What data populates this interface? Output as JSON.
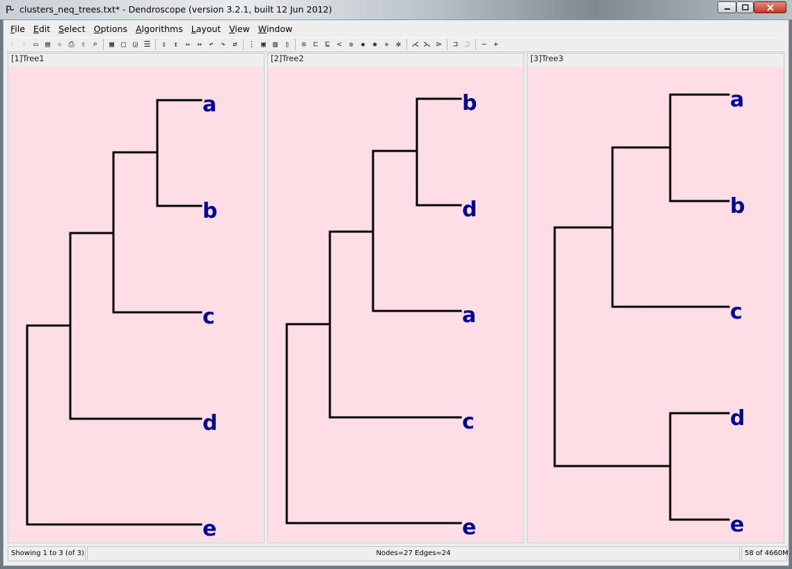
{
  "window": {
    "title": "clusters_neq_trees.txt* - Dendroscope (version 3.2.1, built 12 Jun 2012)"
  },
  "menu": [
    {
      "label": "File",
      "mnemonic": "F",
      "rest": "ile"
    },
    {
      "label": "Edit",
      "mnemonic": "E",
      "rest": "dit"
    },
    {
      "label": "Select",
      "mnemonic": "S",
      "rest": "elect"
    },
    {
      "label": "Options",
      "mnemonic": "O",
      "rest": "ptions"
    },
    {
      "label": "Algorithms",
      "mnemonic": "A",
      "rest": "lgorithms"
    },
    {
      "label": "Layout",
      "mnemonic": "L",
      "rest": "ayout"
    },
    {
      "label": "View",
      "mnemonic": "V",
      "rest": "iew"
    },
    {
      "label": "Window",
      "mnemonic": "W",
      "rest": "indow"
    }
  ],
  "toolbar": [
    {
      "name": "back-icon",
      "glyph": "‹",
      "enabled": false
    },
    {
      "name": "forward-icon",
      "glyph": "›",
      "enabled": false
    },
    {
      "name": "open-icon",
      "glyph": "▭"
    },
    {
      "name": "open-file-icon",
      "glyph": "▤"
    },
    {
      "name": "save-icon",
      "glyph": "▪",
      "enabled": false
    },
    {
      "name": "print-icon",
      "glyph": "⎙"
    },
    {
      "name": "export-icon",
      "glyph": "⇪"
    },
    {
      "name": "find-icon",
      "glyph": "⌕"
    },
    {
      "sep": true
    },
    {
      "name": "grid-icon",
      "glyph": "▦"
    },
    {
      "name": "single-panel-icon",
      "glyph": "□"
    },
    {
      "name": "resize-icon",
      "glyph": "◲"
    },
    {
      "name": "list-icon",
      "glyph": "☰"
    },
    {
      "sep": true
    },
    {
      "name": "expand-vertical-icon",
      "glyph": "⇕"
    },
    {
      "name": "contract-vertical-icon",
      "glyph": "↕"
    },
    {
      "name": "expand-horizontal-icon",
      "glyph": "⇔"
    },
    {
      "name": "contract-horizontal-icon",
      "glyph": "↔"
    },
    {
      "name": "rotate-left-icon",
      "glyph": "↶"
    },
    {
      "name": "rotate-right-icon",
      "glyph": "↷"
    },
    {
      "name": "flip-icon",
      "glyph": "⇄"
    },
    {
      "sep": true
    },
    {
      "name": "select-nodes-icon",
      "glyph": "⋮"
    },
    {
      "name": "zoom-fit-icon",
      "glyph": "▣"
    },
    {
      "name": "zoom-width-icon",
      "glyph": "▥"
    },
    {
      "name": "zoom-height-icon",
      "glyph": "▯"
    },
    {
      "sep": true
    },
    {
      "name": "magnify-icon",
      "glyph": "⊙"
    },
    {
      "name": "rectangular-phylogram-icon",
      "glyph": "⊏"
    },
    {
      "name": "rectangular-cladogram-icon",
      "glyph": "⊑"
    },
    {
      "name": "slanted-cladogram-icon",
      "glyph": "<"
    },
    {
      "name": "circular-phylogram-icon",
      "glyph": "✲"
    },
    {
      "name": "circular-cladogram-icon",
      "glyph": "✹"
    },
    {
      "name": "radial-phylogram-icon",
      "glyph": "✺"
    },
    {
      "name": "radial-cladogram-icon",
      "glyph": "✳"
    },
    {
      "name": "unrooted-icon",
      "glyph": "✼"
    },
    {
      "sep": true
    },
    {
      "name": "reroot-icon",
      "glyph": "⋌"
    },
    {
      "name": "swap-icon",
      "glyph": "⋋"
    },
    {
      "name": "ladderize-icon",
      "glyph": "⋗"
    },
    {
      "sep": true
    },
    {
      "name": "collapse-icon",
      "glyph": "⊐"
    },
    {
      "name": "uncollapse-icon",
      "glyph": "⊒",
      "enabled": false
    },
    {
      "sep": true
    },
    {
      "name": "zoom-out-icon",
      "glyph": "−"
    },
    {
      "name": "zoom-in-icon",
      "glyph": "+"
    }
  ],
  "panels": [
    {
      "label": "[1]Tree1",
      "leaves": [
        "a",
        "b",
        "c",
        "d",
        "e"
      ]
    },
    {
      "label": "[2]Tree2",
      "leaves": [
        "b",
        "d",
        "a",
        "c",
        "e"
      ]
    },
    {
      "label": "[3]Tree3",
      "leaves": [
        "a",
        "b",
        "c",
        "d",
        "e"
      ]
    }
  ],
  "status": {
    "left": "Showing 1 to 3 (of 3)",
    "center": "Nodes=27 Edges=24",
    "right": "58 of 4660M"
  }
}
